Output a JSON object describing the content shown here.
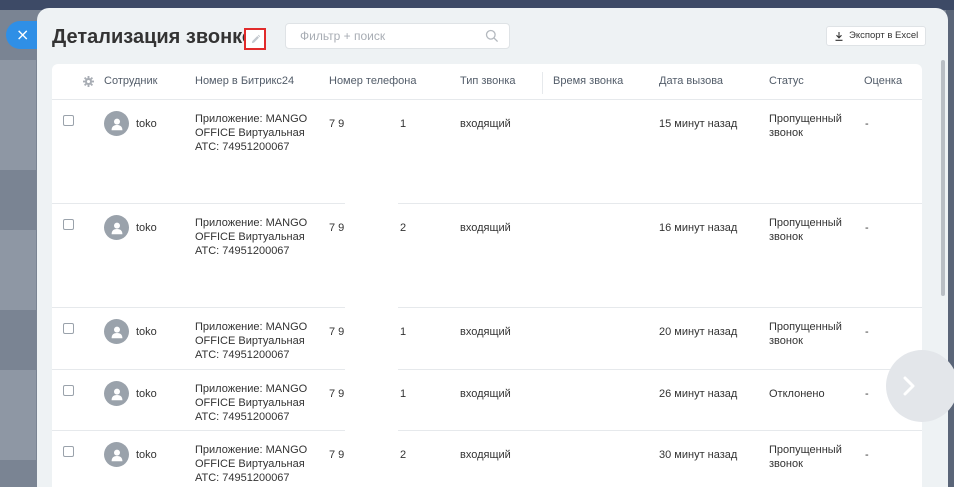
{
  "window": {
    "title": "Детализация звонков",
    "close_label": "×"
  },
  "search": {
    "placeholder": "Фильтр + поиск",
    "value": ""
  },
  "toolbar": {
    "export_label": "Экспорт в Excel"
  },
  "table": {
    "columns": [
      "Сотрудник",
      "Номер в Битрикс24",
      "Номер телефона",
      "Тип звонка",
      "Время звонка",
      "Дата вызова",
      "Статус",
      "Оценка"
    ],
    "rows": [
      {
        "employee": "toko",
        "app_line1": "Приложение: MANGO",
        "app_line2": "OFFICE Виртуальная",
        "app_line3": "АТС: 74951200067",
        "phone_a": "7 9",
        "phone_b": "1",
        "type": "входящий",
        "time": "",
        "date": "15 минут назад",
        "status_line1": "Пропущенный",
        "status_line2": "звонок",
        "rating": "-"
      },
      {
        "employee": "toko",
        "app_line1": "Приложение: MANGO",
        "app_line2": "OFFICE Виртуальная",
        "app_line3": "АТС: 74951200067",
        "phone_a": "7 9",
        "phone_b": "2",
        "type": "входящий",
        "time": "",
        "date": "16 минут назад",
        "status_line1": "Пропущенный",
        "status_line2": "звонок",
        "rating": "-"
      },
      {
        "employee": "toko",
        "app_line1": "Приложение: MANGO",
        "app_line2": "OFFICE Виртуальная",
        "app_line3": "АТС: 74951200067",
        "phone_a": "7 9",
        "phone_b": "1",
        "type": "входящий",
        "time": "",
        "date": "20 минут назад",
        "status_line1": "Пропущенный",
        "status_line2": "звонок",
        "rating": "-"
      },
      {
        "employee": "toko",
        "app_line1": "Приложение: MANGO",
        "app_line2": "OFFICE Виртуальная",
        "app_line3": "АТС: 74951200067",
        "phone_a": "7 9",
        "phone_b": "1",
        "type": "входящий",
        "time": "",
        "date": "26 минут назад",
        "status_line1": "Отклонено",
        "status_line2": "",
        "rating": "-"
      },
      {
        "employee": "toko",
        "app_line1": "Приложение: MANGO",
        "app_line2": "OFFICE Виртуальная",
        "app_line3": "АТС: 74951200067",
        "phone_a": "7 9",
        "phone_b": "2",
        "type": "входящий",
        "time": "",
        "date": "30 минут назад",
        "status_line1": "Пропущенный",
        "status_line2": "звонок",
        "rating": "-"
      }
    ]
  },
  "icons": {
    "close": "close-icon",
    "edit": "pencil-icon",
    "search": "search-icon",
    "export": "download-icon",
    "settings": "gear-icon",
    "avatar": "user-icon",
    "next": "chevron-right-icon"
  },
  "colors": {
    "accent": "#2f8fe6",
    "highlight_border": "#e12b2b",
    "text": "#333333",
    "header_text": "#525c69",
    "avatar_bg": "#9aa2ab"
  }
}
